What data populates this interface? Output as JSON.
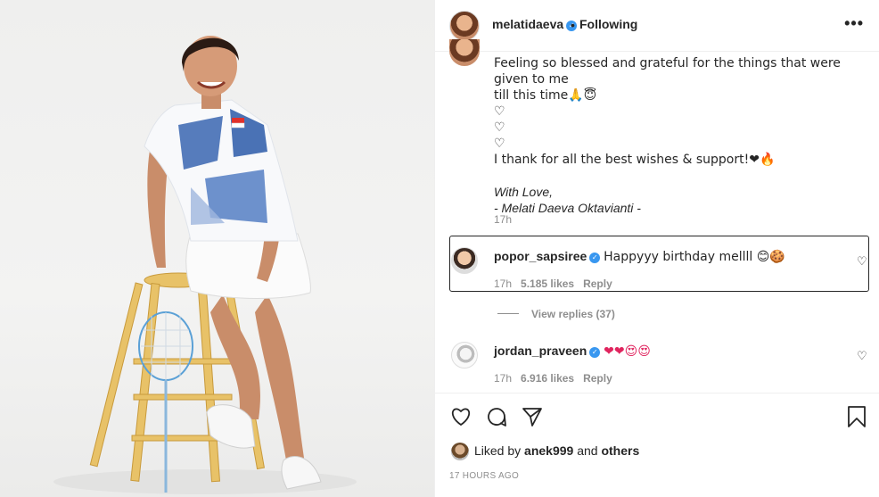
{
  "post": {
    "author": "melatidaeva",
    "separator": "•",
    "follow_status": "Following",
    "more_label": "•••"
  },
  "caption": {
    "lines": [
      "Feeling so blessed and grateful for the things that were given to me",
      "till this time🙏😇",
      "♡",
      "♡",
      "♡",
      "I thank for all the best wishes & support!❤🔥",
      "",
      "With Love,",
      "- Melati Daeva Oktavianti -"
    ],
    "time": "17h"
  },
  "comments": [
    {
      "user": "popor_sapsiree",
      "text": "Happyyy birthday mellll 😊🍪",
      "time": "17h",
      "likes": "5.185 likes",
      "reply": "Reply"
    },
    {
      "user": "jordan_praveen",
      "text": "❤❤😍😍",
      "time": "17h",
      "likes": "6.916 likes",
      "reply": "Reply"
    }
  ],
  "view_replies": "View replies (37)",
  "likes_summary": {
    "prefix": "Liked by",
    "user": "anek999",
    "and": "and",
    "others": "others"
  },
  "posted": "17 HOURS AGO",
  "colors": {
    "verified": "#3897f0",
    "meta": "#8e8e8e",
    "text": "#262626"
  },
  "icons": [
    "heart-icon",
    "comment-icon",
    "share-icon",
    "bookmark-icon",
    "verified-icon",
    "more-icon"
  ]
}
